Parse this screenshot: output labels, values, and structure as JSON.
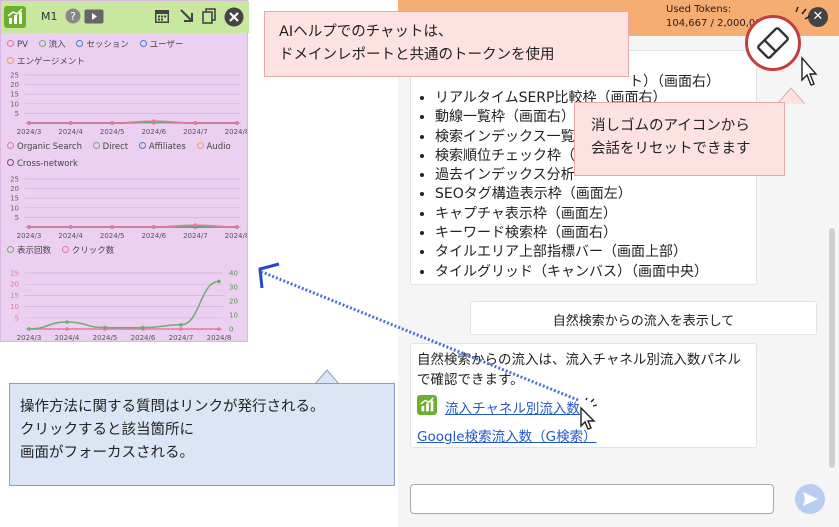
{
  "panel": {
    "name": "M1",
    "legend1": [
      "PV",
      "流入",
      "セッション",
      "ユーザー",
      "エンゲージメント"
    ],
    "legend2": [
      "Organic Search",
      "Direct",
      "Affiliates",
      "Audio",
      "Cross-network"
    ],
    "legend3": [
      "表示回数",
      "クリック数"
    ],
    "colors": {
      "bar": "#c8e8a0",
      "background": "#ecd0f2",
      "logo": "#6cae2e"
    }
  },
  "chart_data": [
    {
      "type": "line",
      "x": [
        "2024/3",
        "2024/4",
        "2024/5",
        "2024/6",
        "2024/7",
        "2024/8"
      ],
      "ylim": [
        0,
        25
      ],
      "yticks": [
        "25",
        "20",
        "15",
        "10",
        "5"
      ],
      "series": [
        {
          "name": "PV",
          "values": [
            0,
            0,
            0,
            1,
            0,
            0
          ]
        },
        {
          "name": "流入",
          "values": [
            0,
            0,
            0,
            0.5,
            0,
            0
          ]
        },
        {
          "name": "セッション",
          "values": [
            0,
            0,
            0,
            0.5,
            0,
            0
          ]
        },
        {
          "name": "ユーザー",
          "values": [
            0,
            0,
            0,
            0.5,
            0,
            0
          ]
        },
        {
          "name": "エンゲージメント",
          "values": [
            0,
            0,
            0,
            0,
            0,
            0
          ]
        }
      ]
    },
    {
      "type": "line",
      "x": [
        "2024/3",
        "2024/4",
        "2024/5",
        "2024/6",
        "2024/7",
        "2024/8"
      ],
      "ylim": [
        0,
        25
      ],
      "yticks": [
        "25",
        "20",
        "15",
        "10",
        "5"
      ],
      "series": [
        {
          "name": "Organic Search",
          "values": [
            0,
            0,
            0,
            0,
            1,
            0
          ]
        },
        {
          "name": "Direct",
          "values": [
            0,
            0,
            0,
            0,
            0.5,
            0
          ]
        },
        {
          "name": "Affiliates",
          "values": [
            0,
            0,
            0,
            0,
            0,
            0
          ]
        },
        {
          "name": "Audio",
          "values": [
            0,
            0,
            0,
            0,
            0,
            0
          ]
        },
        {
          "name": "Cross-network",
          "values": [
            0,
            0,
            0,
            0,
            0.5,
            0
          ]
        }
      ]
    },
    {
      "type": "line",
      "x": [
        "2024/3",
        "2024/4",
        "2024/5",
        "2024/6",
        "2024/7",
        "2024/8"
      ],
      "ylim_left": [
        0,
        25
      ],
      "yticks_left": [
        "25",
        "20",
        "15",
        "10",
        "5"
      ],
      "ylim_right": [
        0,
        40
      ],
      "yticks_right": [
        "40",
        "30",
        "20",
        "10",
        "0"
      ],
      "series": [
        {
          "name": "表示回数",
          "axis": "right",
          "values": [
            0,
            5,
            1,
            1,
            3,
            34
          ]
        },
        {
          "name": "クリック数",
          "axis": "left",
          "values": [
            0,
            0,
            0,
            0,
            0,
            0
          ]
        }
      ]
    }
  ],
  "chat": {
    "tokens_label": "Used Tokens:",
    "tokens_value": "104,667 / 2,000,000",
    "list_partial_first": "ト）（画面右）",
    "list": [
      "リアルタイムSERP比較枠（画面右）",
      "動線一覧枠（画面右）",
      "検索インデックス一覧",
      "検索順位チェック枠（",
      "過去インデックス分析",
      "SEOタグ構造表示枠（画面左）",
      "キャプチャ表示枠（画面左）",
      "キーワード検索枠（画面右）",
      "タイルエリア上部指標バー（画面上部）",
      "タイルグリッド（キャンバス）（画面中央）"
    ],
    "user_message": "自然検索からの流入を表示して",
    "reply_text": "自然検索からの流入は、流入チャネル別流入数パネルで確認できます。",
    "reply_link1": "流入チャネル別流入数",
    "reply_link2": "Google検索流入数（G検索）",
    "input_placeholder": ""
  },
  "callouts": {
    "top_line1": "AIヘルプでのチャットは、",
    "top_line2": "ドメインレポートと共通のトークンを使用",
    "eraser_line1": "消しゴムのアイコンから",
    "eraser_line2": "会話をリセットできます",
    "link_line1": "操作方法に関する質問はリンクが発行される。",
    "link_line2": "クリックすると該当箇所に",
    "link_line3": "画面がフォーカスされる。"
  }
}
